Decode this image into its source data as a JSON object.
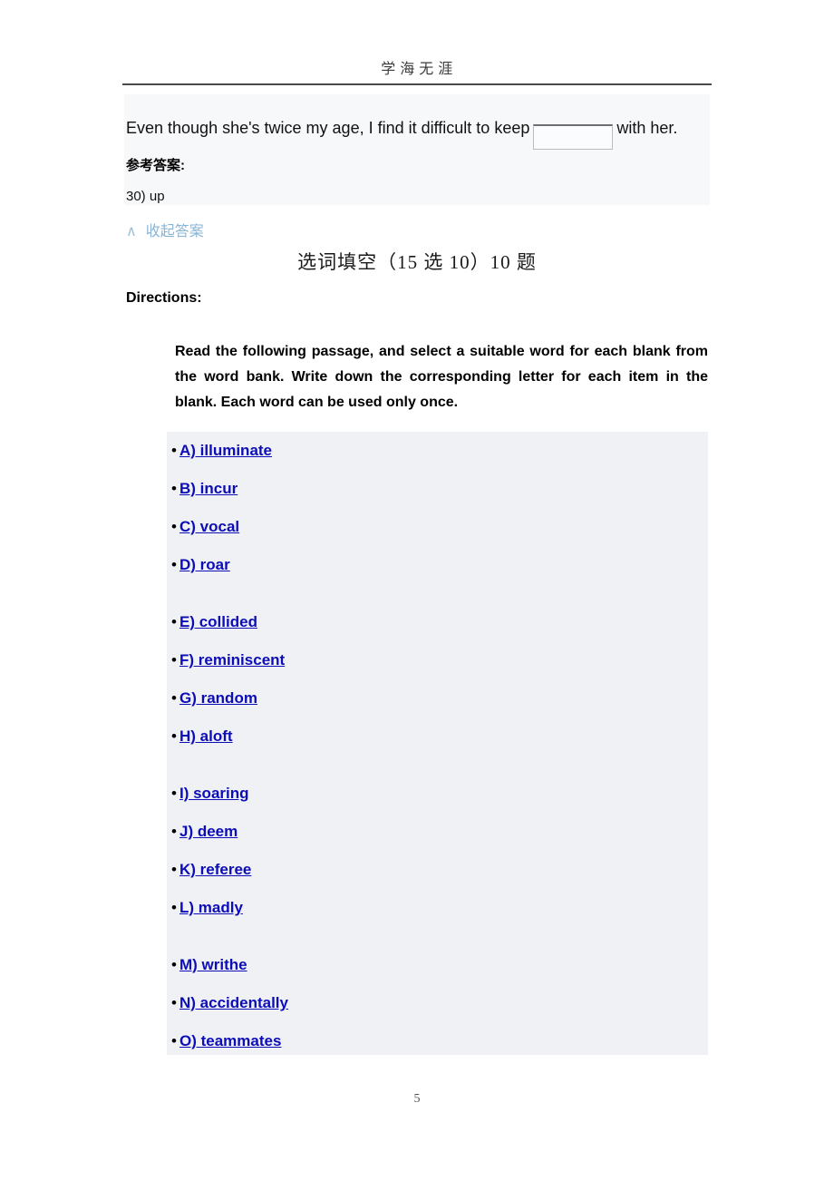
{
  "running_head": "学  海  无  涯",
  "answer_panel": {
    "question_text_before": "Even though she's twice my age, I find it difficult to keep",
    "question_text_after": "with her.",
    "blank_value": "",
    "blank_placeholder": "",
    "answer_label": "参考答案:",
    "answer_value": "30) up",
    "collapse_caret": "∧",
    "collapse_label": "收起答案"
  },
  "section": {
    "title": "选词填空（15 选 10）10 题",
    "directions_label": "Directions:",
    "directions_body": "Read the following passage, and select a suitable word for each blank from the word bank. Write down the corresponding letter for each item in the blank. Each word can be used only once."
  },
  "word_bank": {
    "bullet": "•",
    "items": [
      {
        "label": "A) illuminate",
        "group_end": false
      },
      {
        "label": "B) incur",
        "group_end": false
      },
      {
        "label": "C) vocal",
        "group_end": false
      },
      {
        "label": "D) roar",
        "group_end": true
      },
      {
        "label": "E) collided",
        "group_end": false
      },
      {
        "label": "F) reminiscent",
        "group_end": false
      },
      {
        "label": "G) random",
        "group_end": false
      },
      {
        "label": "H) aloft",
        "group_end": true
      },
      {
        "label": "I) soaring",
        "group_end": false
      },
      {
        "label": "J) deem",
        "group_end": false
      },
      {
        "label": "K) referee",
        "group_end": false
      },
      {
        "label": "L) madly",
        "group_end": true
      },
      {
        "label": "M) writhe",
        "group_end": false
      },
      {
        "label": "N) accidentally",
        "group_end": false
      },
      {
        "label": "O) teammates",
        "group_end": false
      }
    ]
  },
  "footer": {
    "page_number": "5"
  },
  "colors": {
    "link": "#0d0db8",
    "answer_panel_bg": "#f7f8fa",
    "wordbank_bg": "#eff1f4",
    "collapse_link": "#8ab4d4"
  }
}
